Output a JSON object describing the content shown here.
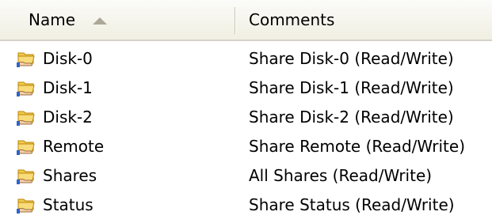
{
  "columns": {
    "name": "Name",
    "comments": "Comments"
  },
  "colors": {
    "header_bg": "#f1efe2",
    "header_border": "#d5d2ca",
    "sort_arrow": "#aca899",
    "folder_yellow": "#f2c94c",
    "hand_blue": "#2f63c9"
  },
  "rows": [
    {
      "name": "Disk-0",
      "comment": "Share Disk-0 (Read/Write)",
      "icon": "shared-folder-icon"
    },
    {
      "name": "Disk-1",
      "comment": "Share Disk-1 (Read/Write)",
      "icon": "shared-folder-icon"
    },
    {
      "name": "Disk-2",
      "comment": "Share Disk-2 (Read/Write)",
      "icon": "shared-folder-icon"
    },
    {
      "name": "Remote",
      "comment": "Share Remote (Read/Write)",
      "icon": "shared-folder-icon"
    },
    {
      "name": "Shares",
      "comment": "All Shares (Read/Write)",
      "icon": "shared-folder-icon"
    },
    {
      "name": "Status",
      "comment": "Share Status (Read/Write)",
      "icon": "shared-folder-icon"
    }
  ]
}
